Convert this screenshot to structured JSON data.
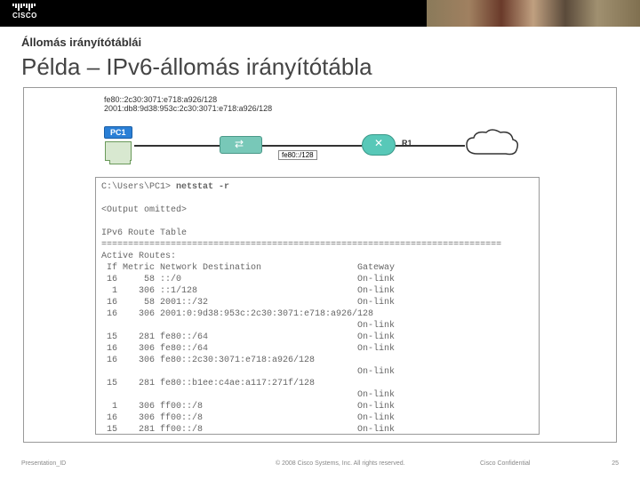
{
  "header": {
    "logo_text": "CISCO"
  },
  "slide": {
    "subtitle": "Állomás irányítótáblái",
    "title": "Példa – IPv6-állomás irányítótábla"
  },
  "diagram": {
    "addr1": "fe80::2c30:3071:e718:a926/128",
    "addr2": "2001:db8:9d38:953c:2c30:3071:e718:a926/128",
    "pc_label": "PC1",
    "router_label": "R1",
    "net_label": "fe80::/128"
  },
  "terminal": {
    "prompt": "C:\\Users\\PC1> ",
    "command": "netstat -r",
    "omitted": "<Output omitted>",
    "heading": "IPv6 Route Table",
    "sep": "===========================================================================",
    "active": "Active Routes:",
    "cols": " If Metric Network Destination                  Gateway",
    "rows": [
      " 16     58 ::/0                                 On-link",
      "  1    306 ::1/128                              On-link",
      " 16     58 2001::/32                            On-link",
      " 16    306 2001:0:9d38:953c:2c30:3071:e718:a926/128",
      "                                                On-link",
      " 15    281 fe80::/64                            On-link",
      " 16    306 fe80::/64                            On-link",
      " 16    306 fe80::2c30:3071:e718:a926/128",
      "                                                On-link",
      " 15    281 fe80::b1ee:c4ae:a117:271f/128",
      "                                                On-link",
      "  1    306 ff00::/8                             On-link",
      " 16    306 ff00::/8                             On-link",
      " 15    281 ff00::/8                             On-link"
    ]
  },
  "footer": {
    "presentation_id": "Presentation_ID",
    "copyright": "© 2008 Cisco Systems, Inc. All rights reserved.",
    "confidential": "Cisco Confidential",
    "page": "25"
  }
}
